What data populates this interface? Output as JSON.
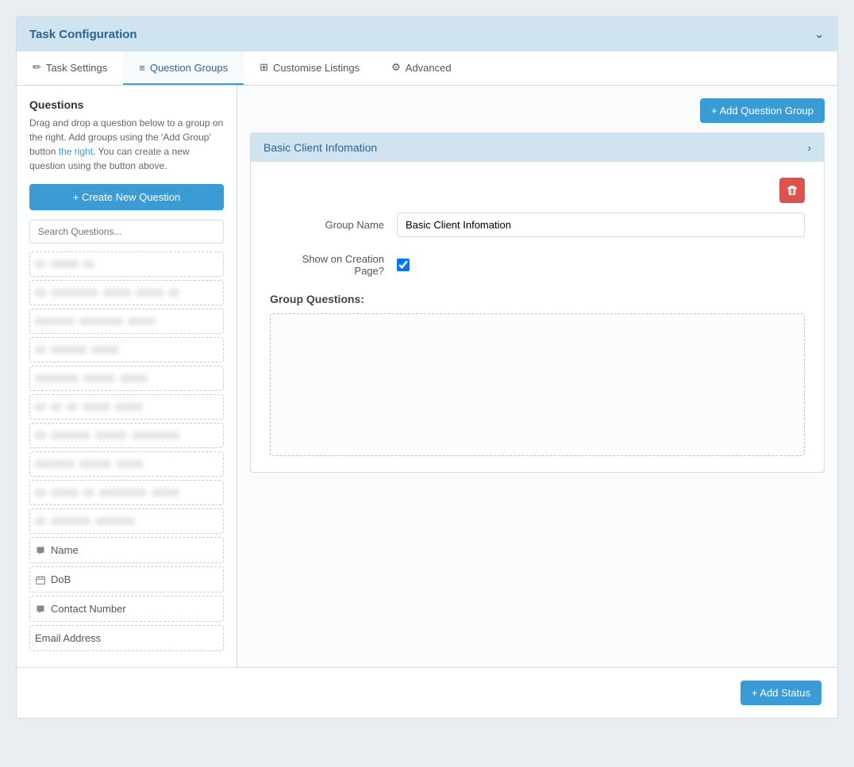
{
  "header": {
    "title": "Task Configuration",
    "chevron": "chevron-down"
  },
  "tabs": [
    {
      "id": "task-settings",
      "label": "Task Settings",
      "icon": "✏️",
      "active": false
    },
    {
      "id": "question-groups",
      "label": "Question Groups",
      "icon": "≡",
      "active": true
    },
    {
      "id": "customise-listings",
      "label": "Customise Listings",
      "icon": "⊞",
      "active": false
    },
    {
      "id": "advanced",
      "label": "Advanced",
      "icon": "⚙️",
      "active": false
    }
  ],
  "sidebar": {
    "heading": "Questions",
    "description_1": "Drag and drop a question below to a group on the right. Add groups using the 'Add Group' button ",
    "description_link": "the right",
    "description_2": ". You can create a new question using the button above.",
    "create_button_label": "+ Create New Question",
    "search_placeholder": "Search Questions...",
    "questions": [
      {
        "id": "name",
        "icon": "comment",
        "label": "Name"
      },
      {
        "id": "dob",
        "icon": "calendar",
        "label": "DoB"
      },
      {
        "id": "contact-number",
        "icon": "comment",
        "label": "Contact Number"
      },
      {
        "id": "email-address",
        "icon": "none",
        "label": "Email Address"
      }
    ]
  },
  "right_panel": {
    "add_group_button_label": "+ Add Question Group",
    "group": {
      "title": "Basic Client Infomation",
      "group_name_label": "Group Name",
      "group_name_value": "Basic Client Infomation",
      "show_on_creation_label": "Show on Creation Page?",
      "show_on_creation_checked": true,
      "group_questions_label": "Group Questions:"
    }
  },
  "bottom_bar": {
    "add_status_label": "+ Add Status"
  }
}
